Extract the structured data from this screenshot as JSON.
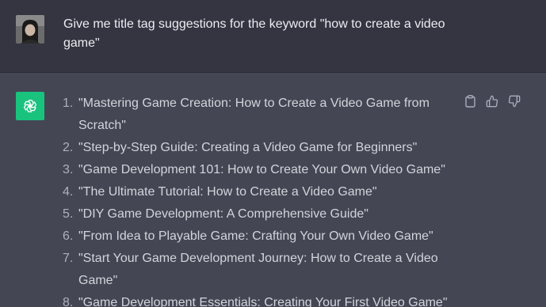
{
  "user_message": {
    "text": "Give me title tag suggestions for the keyword \"how to create a video game\""
  },
  "assistant_message": {
    "items": [
      {
        "num": "1.",
        "text": "\"Mastering Game Creation: How to Create a Video Game from Scratch\""
      },
      {
        "num": "2.",
        "text": "\"Step-by-Step Guide: Creating a Video Game for Beginners\""
      },
      {
        "num": "3.",
        "text": "\"Game Development 101: How to Create Your Own Video Game\""
      },
      {
        "num": "4.",
        "text": "\"The Ultimate Tutorial: How to Create a Video Game\""
      },
      {
        "num": "5.",
        "text": "\"DIY Game Development: A Comprehensive Guide\""
      },
      {
        "num": "6.",
        "text": "\"From Idea to Playable Game: Crafting Your Own Video Game\""
      },
      {
        "num": "7.",
        "text": "\"Start Your Game Development Journey: How to Create a Video Game\""
      },
      {
        "num": "8.",
        "text": "\"Game Development Essentials: Creating Your First Video Game\""
      }
    ]
  },
  "actions": {
    "icons": [
      "clipboard-icon",
      "thumbs-up-icon",
      "thumbs-down-icon"
    ]
  },
  "colors": {
    "user_bg": "#343541",
    "assistant_bg": "#444654",
    "brand_green": "#19c37d"
  }
}
